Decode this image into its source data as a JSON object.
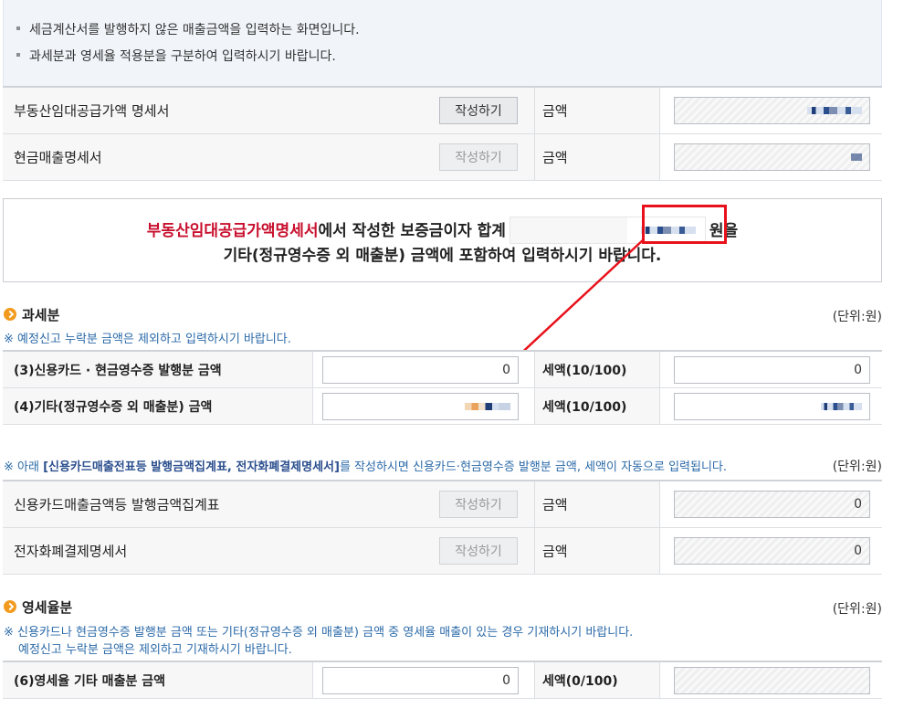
{
  "notice": {
    "line1": "세금계산서를 발행하지 않은 매출금액을 입력하는 화면입니다.",
    "line2": "과세분과 영세율 적용분을 구분하여 입력하시기 바랍니다."
  },
  "table1": {
    "rows": [
      {
        "label": "부동산임대공급가액 명세서",
        "button": "작성하기",
        "amount_label": "금액"
      },
      {
        "label": "현금매출명세서",
        "button": "작성하기",
        "amount_label": "금액"
      }
    ]
  },
  "info_box": {
    "red_text": "부동산임대공급가액명세서",
    "text1": "에서 작성한 보증금이자 합계",
    "unit_text": "원을",
    "line2": "기타(정규영수증 외 매출분) 금액에 포함하여 입력하시기 바랍니다."
  },
  "taxable": {
    "title": "과세분",
    "unit": "(단위:원)",
    "note": "※ 예정신고 누락분 금액은 제외하고 입력하시기 바랍니다.",
    "rows": [
      {
        "label": "(3)신용카드 · 현금영수증 발행분 금액",
        "value": "0",
        "tax_label": "세액(10/100)",
        "tax_value": "0"
      },
      {
        "label": "(4)기타(정규영수증 외 매출분) 금액",
        "value": "",
        "tax_label": "세액(10/100)",
        "tax_value": ""
      }
    ]
  },
  "auto_section": {
    "note_prefix": "※ 아래 ",
    "note_strong": "[신용카드매출전표등 발행금액집계표, 전자화폐결제명세서]",
    "note_suffix": "를 작성하시면 신용카드·현금영수증 발행분 금액, 세액이 자동으로 입력됩니다.",
    "unit": "(단위:원)",
    "rows": [
      {
        "label": "신용카드매출금액등 발행금액집계표",
        "button": "작성하기",
        "amount_label": "금액",
        "value": "0"
      },
      {
        "label": "전자화폐결제명세서",
        "button": "작성하기",
        "amount_label": "금액",
        "value": "0"
      }
    ]
  },
  "zero_rate": {
    "title": "영세율분",
    "unit": "(단위:원)",
    "note1": "※ 신용카드나 현금영수증 발행분 금액 또는 기타(정규영수증 외 매출분) 금액 중 영세율 매출이 있는 경우 기재하시기 바랍니다.",
    "note2": "예정신고 누락분 금액은 제외하고 기재하시기 바랍니다.",
    "row": {
      "label": "(6)영세율 기타 매출분 금액",
      "value": "0",
      "tax_label": "세액(0/100)",
      "tax_value": ""
    }
  },
  "colors": {
    "accent_red": "#c8102e",
    "highlight_red": "#e8111b",
    "note_blue": "#2b6aa8",
    "section_dot": "#f29a1d"
  }
}
